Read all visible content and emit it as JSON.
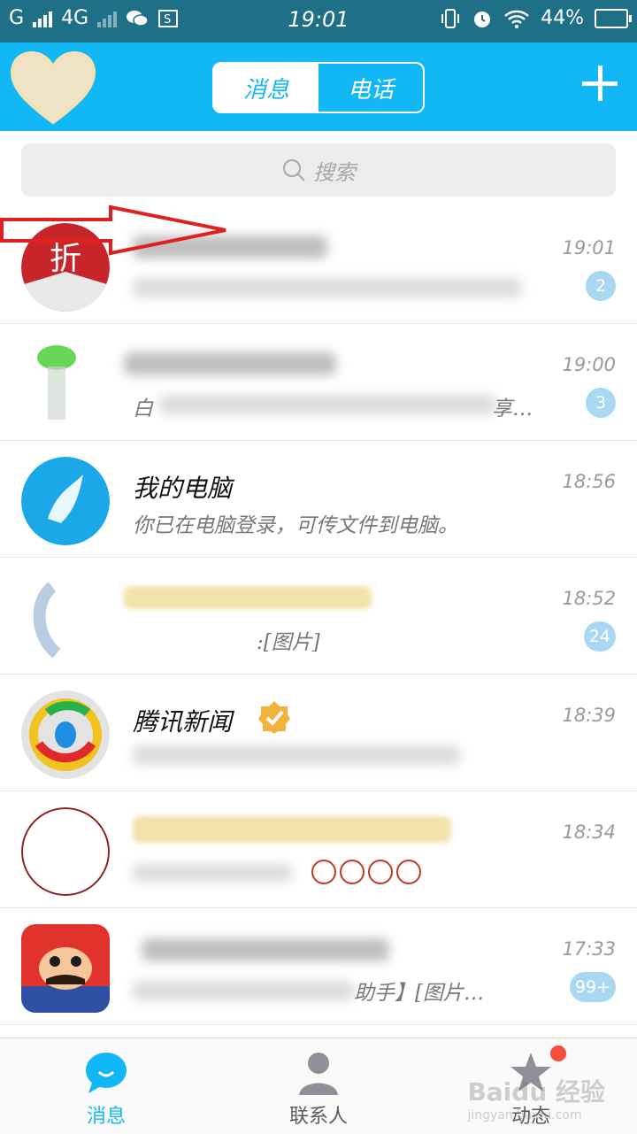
{
  "status_bar": {
    "carrier": "G",
    "network": "4G",
    "time": "19:01",
    "battery": "44%"
  },
  "header": {
    "tabs": [
      {
        "label": "消息",
        "active": true
      },
      {
        "label": "电话",
        "active": false
      }
    ],
    "accent_color": "#12b7f5"
  },
  "search": {
    "placeholder": "搜索"
  },
  "conversations": [
    {
      "name": "",
      "preview": "",
      "time": "19:01",
      "badge": "2"
    },
    {
      "name": "",
      "preview": "白",
      "preview_end": "享…",
      "time": "19:00",
      "badge": "3"
    },
    {
      "name": "我的电脑",
      "preview": "你已在电脑登录，可传文件到电脑。",
      "time": "18:56",
      "badge": ""
    },
    {
      "name": "",
      "preview": ":[图片]",
      "time": "18:52",
      "badge": "24"
    },
    {
      "name": "腾讯新闻",
      "preview": "",
      "time": "18:39",
      "badge": ""
    },
    {
      "name": "",
      "preview": "",
      "time": "18:34",
      "badge": ""
    },
    {
      "name": "",
      "preview": "助手】[图片…",
      "time": "17:33",
      "badge": "99+"
    }
  ],
  "tabbar": {
    "items": [
      {
        "label": "消息",
        "icon": "chat-bubble-icon",
        "active": true
      },
      {
        "label": "联系人",
        "icon": "person-icon",
        "active": false
      },
      {
        "label": "动态",
        "icon": "star-icon",
        "active": false
      }
    ]
  },
  "watermark": {
    "text": "Baidu 经验",
    "sub": "jingyan.baidu.com"
  }
}
